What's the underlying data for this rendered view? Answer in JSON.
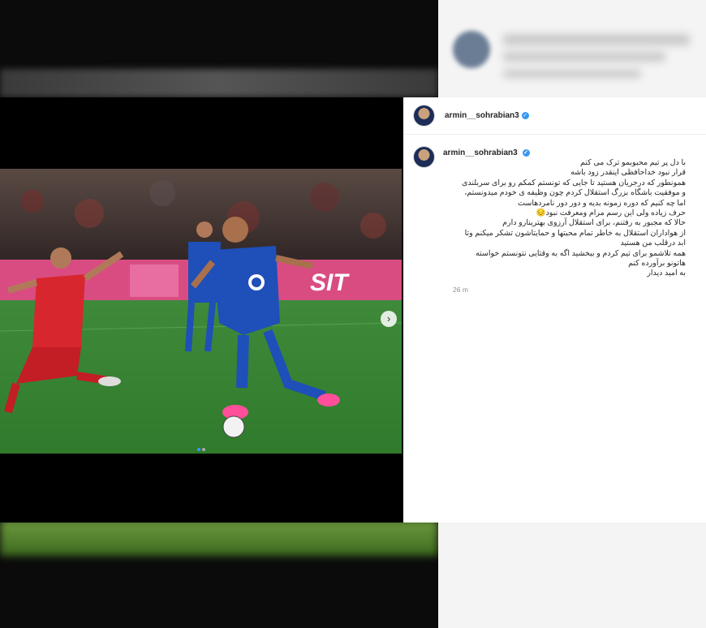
{
  "post": {
    "username": "armin__sohrabian3",
    "verified_icon": "verified-badge-icon",
    "caption_lines": [
      "با دل پر تیم محبوبمو ترک می کنم",
      "قرار نبود خداحافظی اینقدر زود باشه",
      "همونطور که درجریان هستید تا جایی که تونستم کمکم رو برای سربلندی",
      "و موفقیت باشگاه بزرگ استقلال کردم چون وظیفه ی خودم میدونستم،",
      "اما چه کنیم که دوره زمونه بدیه و دور دور نامردهاست",
      "حرف زیاده ولی این رسم مرام ومعرفت نبود😔",
      "حالا که مجبور به رفتنم، برای استقلال آرزوی بهترینارو دارم",
      "از هواداران استقلال به خاطر تمام محبتها و حمایتاشون تشکر میکنم وتا",
      "ابد درقلب من هستید",
      "همه تلاشمو برای تیم کردم و ببخشید اگه به وقتایی نتونستم خواسته",
      "هاتونو برآورده کنم",
      "به امید دیدار"
    ],
    "timestamp": "26 m",
    "next_icon": "chevron-right-icon",
    "carousel": {
      "count": 2,
      "active": 1
    }
  },
  "colors": {
    "verified": "#3897f0",
    "home_kit": "#1f4fb8",
    "away_kit": "#d8262e"
  }
}
